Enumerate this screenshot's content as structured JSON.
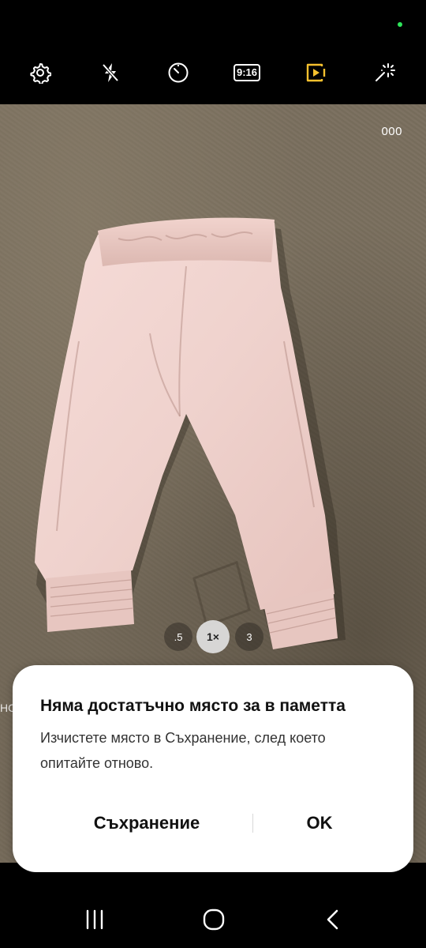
{
  "status_bar": {
    "indicator_color": "#2ee55a"
  },
  "toolbar": {
    "icons": [
      "gear-icon",
      "flash-off-icon",
      "timer-icon",
      "aspect-ratio-icon",
      "motion-photo-icon",
      "filter-wand-icon"
    ],
    "aspect_ratio": "9:16",
    "active_color": "#f5c02e"
  },
  "viewfinder": {
    "counter": "000",
    "side_text": "HO",
    "zoom": {
      "options": [
        ".5",
        "1×",
        "3"
      ],
      "selected": "1×"
    }
  },
  "dialog": {
    "title": "Няма достатъчно място за в паметта",
    "message": "Изчистете място в Съхранение, след което опитайте отново.",
    "storage_button": "Съхранение",
    "ok_button": "OK"
  },
  "navbar": {
    "icons": [
      "recent-apps-icon",
      "home-icon",
      "back-icon"
    ]
  }
}
